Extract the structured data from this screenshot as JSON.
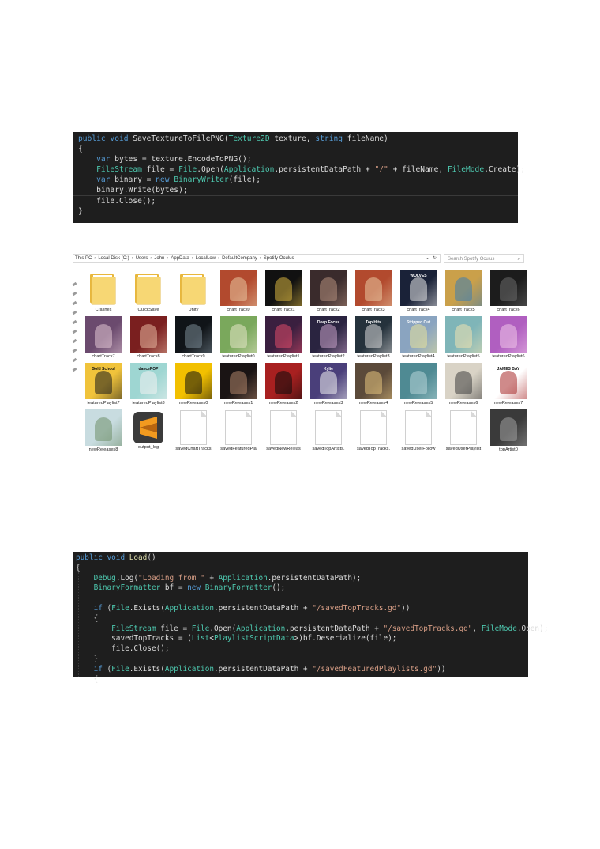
{
  "code_top": {
    "lines": [
      [
        {
          "t": "public void ",
          "c": "kw"
        },
        {
          "t": "SaveTextureToFilePNG",
          "c": "pl"
        },
        {
          "t": "(",
          "c": "pl"
        },
        {
          "t": "Texture2D",
          "c": "ty"
        },
        {
          "t": " texture, ",
          "c": "pl"
        },
        {
          "t": "string",
          "c": "kw"
        },
        {
          "t": " fileName)",
          "c": "pl"
        }
      ],
      [
        {
          "t": "{",
          "c": "pl"
        }
      ],
      [
        {
          "t": "    ",
          "c": "pl"
        },
        {
          "t": "var",
          "c": "kw"
        },
        {
          "t": " bytes = texture.EncodeToPNG();",
          "c": "pl"
        }
      ],
      [
        {
          "t": "    ",
          "c": "pl"
        },
        {
          "t": "FileStream",
          "c": "ty"
        },
        {
          "t": " file = ",
          "c": "pl"
        },
        {
          "t": "File",
          "c": "ty"
        },
        {
          "t": ".Open(",
          "c": "pl"
        },
        {
          "t": "Application",
          "c": "ty"
        },
        {
          "t": ".persistentDataPath + ",
          "c": "pl"
        },
        {
          "t": "\"/\"",
          "c": "st"
        },
        {
          "t": " + fileName, ",
          "c": "pl"
        },
        {
          "t": "FileMode",
          "c": "ty"
        },
        {
          "t": ".Create);",
          "c": "pl"
        }
      ],
      [
        {
          "t": "    ",
          "c": "pl"
        },
        {
          "t": "var",
          "c": "kw"
        },
        {
          "t": " binary = ",
          "c": "pl"
        },
        {
          "t": "new",
          "c": "kw"
        },
        {
          "t": " ",
          "c": "pl"
        },
        {
          "t": "BinaryWriter",
          "c": "ty"
        },
        {
          "t": "(file);",
          "c": "pl"
        }
      ],
      [
        {
          "t": "    binary.Write(bytes);",
          "c": "pl"
        }
      ],
      [
        {
          "t": "    file.Close();",
          "c": "pl"
        }
      ],
      [
        {
          "t": "}",
          "c": "pl"
        }
      ]
    ]
  },
  "explorer": {
    "breadcrumb": [
      "This PC",
      "Local Disk (C:)",
      "Users",
      "John",
      "AppData",
      "LocalLow",
      "DefaultCompany",
      "Spotify Oculus"
    ],
    "search_placeholder": "Search Spotify Oculus",
    "rows": [
      [
        {
          "name": "Crashes",
          "kind": "folder"
        },
        {
          "name": "QuickSave",
          "kind": "folder"
        },
        {
          "name": "Unity",
          "kind": "folder"
        },
        {
          "name": "chartTrack0",
          "kind": "art",
          "bg": "#b24a2e",
          "accent": "#e9c9a3"
        },
        {
          "name": "chartTrack1",
          "kind": "art",
          "bg": "#111111",
          "accent": "#d7b440"
        },
        {
          "name": "chartTrack2",
          "kind": "art",
          "bg": "#3a2b2c",
          "accent": "#b58f7e"
        },
        {
          "name": "chartTrack3",
          "kind": "art",
          "bg": "#b24a2e",
          "accent": "#e9c9a3"
        },
        {
          "name": "chartTrack4",
          "kind": "art",
          "bg": "#1a2238",
          "accent": "#e8e8e8",
          "text": "WOLVES"
        },
        {
          "name": "chartTrack5",
          "kind": "art",
          "bg": "#caa04a",
          "accent": "#3d7db3"
        },
        {
          "name": "chartTrack6",
          "kind": "art",
          "bg": "#1c1c1c",
          "accent": "#6b6b6b"
        }
      ],
      [
        {
          "name": "chartTrack7",
          "kind": "art",
          "bg": "#6b4a6e",
          "accent": "#e2c6d4"
        },
        {
          "name": "chartTrack8",
          "kind": "art",
          "bg": "#7a1f1f",
          "accent": "#e8b8a0"
        },
        {
          "name": "chartTrack9",
          "kind": "art",
          "bg": "#101418",
          "accent": "#7a8a95"
        },
        {
          "name": "featuredPlaylist0",
          "kind": "art",
          "bg": "#7aa85c",
          "accent": "#e6e6c8"
        },
        {
          "name": "featuredPlaylist1",
          "kind": "art",
          "bg": "#3a1f3f",
          "accent": "#e04b6a"
        },
        {
          "name": "featuredPlaylist2",
          "kind": "art",
          "bg": "#2a2440",
          "accent": "#c9a2c9",
          "text": "Deep Focus"
        },
        {
          "name": "featuredPlaylist3",
          "kind": "art",
          "bg": "#25323c",
          "accent": "#d9d9d9",
          "text": "Top Hits"
        },
        {
          "name": "featuredPlaylist4",
          "kind": "art",
          "bg": "#8aa4c0",
          "accent": "#e8e29a",
          "text": "Stripped Out"
        },
        {
          "name": "featuredPlaylist5",
          "kind": "art",
          "bg": "#7fb5b8",
          "accent": "#f1e2b0"
        },
        {
          "name": "featuredPlaylist6",
          "kind": "art",
          "bg": "#b05fc0",
          "accent": "#f0c6e8"
        }
      ],
      [
        {
          "name": "featuredPlaylist7",
          "kind": "art",
          "bg": "#f0c33b",
          "accent": "#1b1b1b",
          "text": "Gold School"
        },
        {
          "name": "featuredPlaylist8",
          "kind": "art",
          "bg": "#9ed6d2",
          "accent": "#f3f3f3",
          "text": "dancePOP"
        },
        {
          "name": "newReleases0",
          "kind": "art",
          "bg": "#f2c000",
          "accent": "#111111"
        },
        {
          "name": "newReleases1",
          "kind": "art",
          "bg": "#1a1414",
          "accent": "#b0856a"
        },
        {
          "name": "newReleases2",
          "kind": "art",
          "bg": "#a82020",
          "accent": "#0b0b0b"
        },
        {
          "name": "newReleases3",
          "kind": "art",
          "bg": "#4a3f7a",
          "accent": "#f2f2f2",
          "text": "Kylie"
        },
        {
          "name": "newReleases4",
          "kind": "art",
          "bg": "#5b4a3a",
          "accent": "#e6c47e"
        },
        {
          "name": "newReleases5",
          "kind": "art",
          "bg": "#4f8a93",
          "accent": "#b8d6d8"
        },
        {
          "name": "newReleases6",
          "kind": "art",
          "bg": "#d9d3c6",
          "accent": "#404040"
        },
        {
          "name": "newReleases7",
          "kind": "art",
          "bg": "#ffffff",
          "accent": "#a82a2a",
          "text": "JAMES BAY"
        }
      ],
      [
        {
          "name": "newReleases8",
          "kind": "art",
          "bg": "#c8dce0",
          "accent": "#6f8f6a"
        },
        {
          "name": "output_log",
          "kind": "sublime"
        },
        {
          "name": "savedChartTracks",
          "kind": "file"
        },
        {
          "name": "savedFeaturedPla",
          "kind": "file"
        },
        {
          "name": "savedNewReleas",
          "kind": "file"
        },
        {
          "name": "savedTopArtists.",
          "kind": "file"
        },
        {
          "name": "savedTopTracks.",
          "kind": "file"
        },
        {
          "name": "savedUserFollow",
          "kind": "file"
        },
        {
          "name": "savedUserPlaylist",
          "kind": "file"
        },
        {
          "name": "topArtist0",
          "kind": "art",
          "bg": "#3a3a3a",
          "accent": "#a0a0a0"
        }
      ]
    ]
  },
  "code_bottom": {
    "lines": [
      [
        {
          "t": "public void ",
          "c": "kw"
        },
        {
          "t": "Load",
          "c": "fn"
        },
        {
          "t": "()",
          "c": "pl"
        }
      ],
      [
        {
          "t": "{",
          "c": "pl"
        }
      ],
      [
        {
          "t": "    ",
          "c": "pl"
        },
        {
          "t": "Debug",
          "c": "ty"
        },
        {
          "t": ".Log(",
          "c": "pl"
        },
        {
          "t": "\"Loading from \"",
          "c": "st"
        },
        {
          "t": " + ",
          "c": "pl"
        },
        {
          "t": "Application",
          "c": "ty"
        },
        {
          "t": ".persistentDataPath);",
          "c": "pl"
        }
      ],
      [
        {
          "t": "    ",
          "c": "pl"
        },
        {
          "t": "BinaryFormatter",
          "c": "ty"
        },
        {
          "t": " bf = ",
          "c": "pl"
        },
        {
          "t": "new",
          "c": "kw"
        },
        {
          "t": " ",
          "c": "pl"
        },
        {
          "t": "BinaryFormatter",
          "c": "ty"
        },
        {
          "t": "();",
          "c": "pl"
        }
      ],
      [
        {
          "t": "",
          "c": "pl"
        }
      ],
      [
        {
          "t": "    ",
          "c": "pl"
        },
        {
          "t": "if",
          "c": "kw"
        },
        {
          "t": " (",
          "c": "pl"
        },
        {
          "t": "File",
          "c": "ty"
        },
        {
          "t": ".Exists(",
          "c": "pl"
        },
        {
          "t": "Application",
          "c": "ty"
        },
        {
          "t": ".persistentDataPath + ",
          "c": "pl"
        },
        {
          "t": "\"/savedTopTracks.gd\"",
          "c": "st"
        },
        {
          "t": "))",
          "c": "pl"
        }
      ],
      [
        {
          "t": "    {",
          "c": "pl"
        }
      ],
      [
        {
          "t": "        ",
          "c": "pl"
        },
        {
          "t": "FileStream",
          "c": "ty"
        },
        {
          "t": " file = ",
          "c": "pl"
        },
        {
          "t": "File",
          "c": "ty"
        },
        {
          "t": ".Open(",
          "c": "pl"
        },
        {
          "t": "Application",
          "c": "ty"
        },
        {
          "t": ".persistentDataPath + ",
          "c": "pl"
        },
        {
          "t": "\"/savedTopTracks.gd\"",
          "c": "st"
        },
        {
          "t": ", ",
          "c": "pl"
        },
        {
          "t": "FileMode",
          "c": "ty"
        },
        {
          "t": ".Open);",
          "c": "pl"
        }
      ],
      [
        {
          "t": "        savedTopTracks = (",
          "c": "pl"
        },
        {
          "t": "List",
          "c": "ty"
        },
        {
          "t": "<",
          "c": "pl"
        },
        {
          "t": "PlaylistScriptData",
          "c": "ty"
        },
        {
          "t": ">)bf.Deserialize(file);",
          "c": "pl"
        }
      ],
      [
        {
          "t": "        file.Close();",
          "c": "pl"
        }
      ],
      [
        {
          "t": "    }",
          "c": "pl"
        }
      ],
      [
        {
          "t": "    ",
          "c": "pl"
        },
        {
          "t": "if",
          "c": "kw"
        },
        {
          "t": " (",
          "c": "pl"
        },
        {
          "t": "File",
          "c": "ty"
        },
        {
          "t": ".Exists(",
          "c": "pl"
        },
        {
          "t": "Application",
          "c": "ty"
        },
        {
          "t": ".persistentDataPath + ",
          "c": "pl"
        },
        {
          "t": "\"/savedFeaturedPlaylists.gd\"",
          "c": "st"
        },
        {
          "t": "))",
          "c": "pl"
        }
      ],
      [
        {
          "t": "    {",
          "c": "pl"
        }
      ]
    ]
  }
}
